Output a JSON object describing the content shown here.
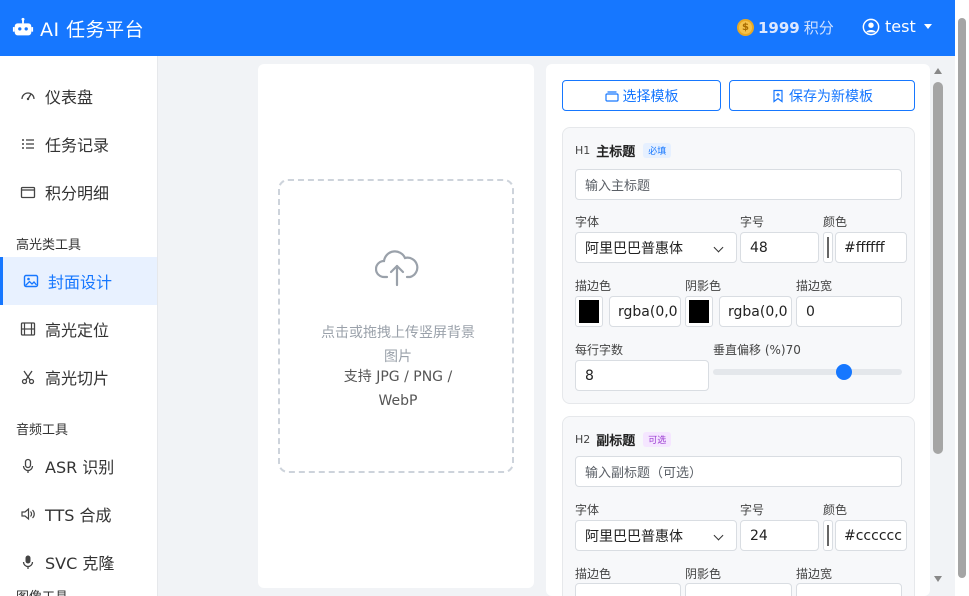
{
  "header": {
    "app_title": "AI 任务平台",
    "points_value": "1999",
    "points_unit": "积分",
    "username": "test",
    "bg_color": "#1677ff"
  },
  "sidebar": {
    "items": [
      {
        "label": "仪表盘",
        "icon": "gauge-icon"
      },
      {
        "label": "任务记录",
        "icon": "list-icon"
      },
      {
        "label": "积分明细",
        "icon": "wallet-icon"
      }
    ],
    "group_highlight": "高光类工具",
    "highlight_items": [
      {
        "label": "封面设计",
        "icon": "image-icon",
        "active": true
      },
      {
        "label": "高光定位",
        "icon": "film-icon"
      },
      {
        "label": "高光切片",
        "icon": "scissors-icon"
      }
    ],
    "group_audio": "音频工具",
    "audio_items": [
      {
        "label": "ASR 识别",
        "icon": "microphone-icon"
      },
      {
        "label": "TTS 合成",
        "icon": "speaker-icon"
      },
      {
        "label": "SVC 克隆",
        "icon": "microphone-icon"
      }
    ],
    "group_image": "图像工具"
  },
  "upload": {
    "hint": "点击或拖拽上传竖屏背景图片",
    "formats": "支持 JPG / PNG / WebP"
  },
  "form": {
    "select_template": "选择模板",
    "save_template": "保存为新模板",
    "h1": {
      "tag": "H1",
      "name": "主标题",
      "badge": "必填",
      "placeholder": "输入主标题",
      "font_label": "字体",
      "font_value": "阿里巴巴普惠体",
      "size_label": "字号",
      "size_value": "48",
      "color_label": "颜色",
      "color_value": "#ffffff",
      "stroke_color_label": "描边色",
      "stroke_color_value": "rgba(0,0",
      "shadow_label": "阴影色",
      "shadow_value": "rgba(0,0",
      "stroke_width_label": "描边宽",
      "stroke_width_value": "0",
      "chars_label": "每行字数",
      "chars_value": "8",
      "offset_label": "垂直偏移 (%)70",
      "offset_percent": 70
    },
    "h2": {
      "tag": "H2",
      "name": "副标题",
      "badge": "可选",
      "placeholder": "输入副标题（可选）",
      "font_label": "字体",
      "font_value": "阿里巴巴普惠体",
      "size_label": "字号",
      "size_value": "24",
      "color_label": "颜色",
      "color_value": "#cccccc",
      "stroke_color_label": "描边色",
      "shadow_label": "阴影色",
      "stroke_width_label": "描边宽"
    }
  }
}
